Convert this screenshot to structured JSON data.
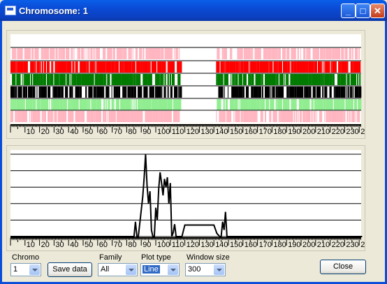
{
  "window": {
    "title": "Chromosome: 1"
  },
  "track_colors": [
    "#FFB6C1",
    "#FF0000",
    "#007A00",
    "#000000",
    "#90EE90",
    "#FFB6C1"
  ],
  "tick_labels": [
    "10",
    "20",
    "30",
    "40",
    "50",
    "60",
    "70",
    "80",
    "90",
    "100",
    "110",
    "120",
    "130",
    "140",
    "150",
    "160",
    "170",
    "180",
    "190",
    "200",
    "210",
    "220",
    "230",
    "24("
  ],
  "chart_data": {
    "type": "line",
    "title": "",
    "xlabel": "",
    "ylabel": "",
    "xlim": [
      0,
      242
    ],
    "grid": true,
    "series": [
      {
        "x": [
          0,
          85,
          86,
          87,
          88,
          91,
          92,
          93,
          94,
          95,
          96,
          97,
          98,
          99,
          100,
          101,
          102,
          103,
          104,
          105,
          106,
          107,
          108,
          109,
          110,
          111,
          112,
          113,
          114,
          118,
          120,
          125,
          135,
          140,
          142,
          143,
          144,
          145,
          146,
          147,
          148,
          149,
          152,
          242
        ],
        "y": [
          0,
          0,
          18,
          0,
          0,
          48,
          72,
          100,
          62,
          40,
          55,
          8,
          0,
          0,
          35,
          20,
          58,
          78,
          65,
          50,
          70,
          60,
          72,
          40,
          65,
          0,
          5,
          15,
          0,
          0,
          14,
          14,
          14,
          14,
          4,
          2,
          0,
          0,
          18,
          8,
          30,
          0,
          0,
          0
        ]
      }
    ]
  },
  "controls": {
    "chromo_label": "Chromo",
    "chromo_value": "1",
    "save_label": "Save data",
    "family_label": "Family",
    "family_value": "All",
    "plot_type_label": "Plot type",
    "plot_type_value": "Line",
    "window_size_label": "Window size",
    "window_size_value": "300",
    "close_label": "Close"
  }
}
